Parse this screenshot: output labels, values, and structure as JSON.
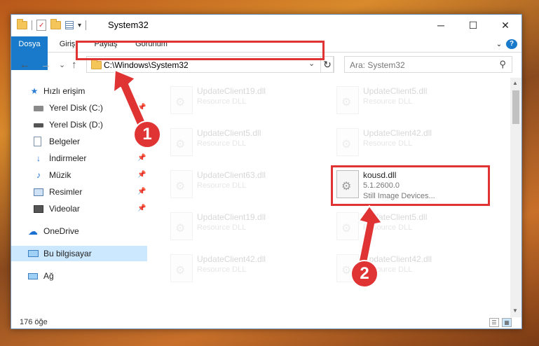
{
  "window": {
    "title": "System32",
    "minimize": "─",
    "maximize": "☐",
    "close": "✕"
  },
  "quick_access_toolbar": {
    "dropdown": "▾"
  },
  "ribbon": {
    "tabs": [
      "Dosya",
      "Giriş",
      "Paylaş",
      "Görünüm"
    ],
    "collapse": "⌄",
    "help": "?"
  },
  "address_bar": {
    "back": "←",
    "forward": "→",
    "recent": "⌄",
    "up": "↑",
    "path": "C:\\Windows\\System32",
    "dropdown": "⌄",
    "refresh": "↻"
  },
  "search": {
    "placeholder": "Ara: System32",
    "icon": "search-icon"
  },
  "sidebar": {
    "items": [
      {
        "label": "Hızlı erişim",
        "icon": "star-icon",
        "pinned": false
      },
      {
        "label": "Yerel Disk (C:)",
        "icon": "drive-icon",
        "pinned": true
      },
      {
        "label": "Yerel Disk (D:)",
        "icon": "drive-icon",
        "pinned": false
      },
      {
        "label": "Belgeler",
        "icon": "documents-icon",
        "pinned": true
      },
      {
        "label": "İndirmeler",
        "icon": "downloads-icon",
        "pinned": true
      },
      {
        "label": "Müzik",
        "icon": "music-icon",
        "pinned": true
      },
      {
        "label": "Resimler",
        "icon": "pictures-icon",
        "pinned": true
      },
      {
        "label": "Videolar",
        "icon": "videos-icon",
        "pinned": true
      },
      {
        "label": "OneDrive",
        "icon": "cloud-icon",
        "pinned": false
      },
      {
        "label": "Bu bilgisayar",
        "icon": "computer-icon",
        "pinned": false,
        "selected": true
      },
      {
        "label": "Ağ",
        "icon": "network-icon",
        "pinned": false
      }
    ]
  },
  "files": [
    {
      "name": "UpdateClient19.dll",
      "desc": "Resource DLL",
      "faded": true
    },
    {
      "name": "UpdateClient5.dll",
      "desc": "Resource DLL",
      "faded": true
    },
    {
      "name": "UpdateClient5.dll",
      "desc": "Resource DLL",
      "faded": true
    },
    {
      "name": "UpdateClient42.dll",
      "desc": "Resource DLL",
      "faded": true
    },
    {
      "name": "UpdateClient63.dll",
      "desc": "Resource DLL",
      "faded": true
    },
    {
      "name": "kousd.dll",
      "version": "5.1.2600.0",
      "desc": "Still Image Devices...",
      "faded": false
    },
    {
      "name": "UpdateClient19.dll",
      "desc": "Resource DLL",
      "faded": true
    },
    {
      "name": "UpdateClient5.dll",
      "desc": "Resource DLL",
      "faded": true
    },
    {
      "name": "UpdateClient42.dll",
      "desc": "Resource DLL",
      "faded": true
    },
    {
      "name": "UpdateClient42.dll",
      "desc": "Resource DLL",
      "faded": true
    }
  ],
  "scrollbar": {
    "up": "▲",
    "down": "▼"
  },
  "status": {
    "count": "176 öğe"
  },
  "annotations": {
    "step1": "1",
    "step2": "2",
    "color": "#e03434"
  }
}
